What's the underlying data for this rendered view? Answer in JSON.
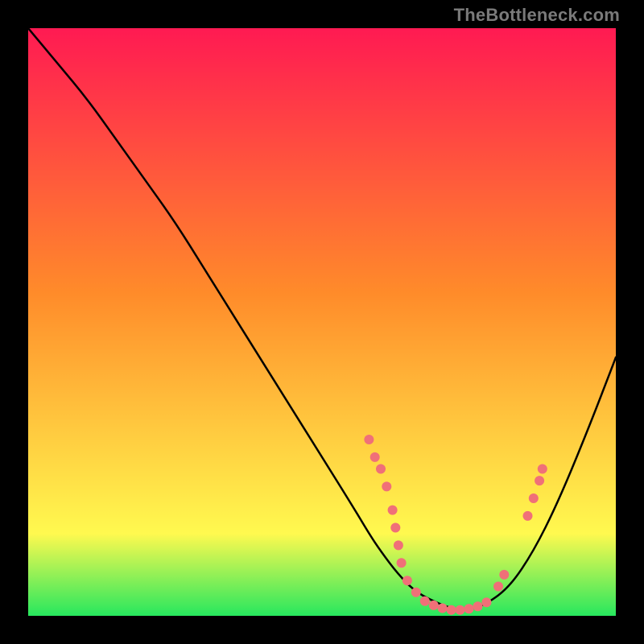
{
  "watermark": "TheBottleneck.com",
  "gradient": {
    "top": "#ff1a52",
    "mid1": "#ff8b2a",
    "mid2": "#fff94f",
    "bottom": "#27e75e"
  },
  "chart_data": {
    "type": "line",
    "title": "",
    "xlabel": "",
    "ylabel": "",
    "xlim": [
      0,
      100
    ],
    "ylim": [
      0,
      100
    ],
    "grid": false,
    "legend": false,
    "annotations": [],
    "series": [
      {
        "name": "bottleneck-curve",
        "x": [
          0,
          5,
          10,
          15,
          20,
          25,
          30,
          35,
          40,
          45,
          50,
          55,
          58,
          60,
          63,
          66,
          70,
          73,
          75,
          78,
          82,
          86,
          90,
          95,
          100
        ],
        "y": [
          100,
          94,
          88,
          81,
          74,
          67,
          59,
          51,
          43,
          35,
          27,
          19,
          14,
          11,
          7,
          4,
          2,
          1,
          1,
          2,
          5,
          11,
          19,
          31,
          44
        ]
      }
    ],
    "scatter_points": {
      "name": "marker-dots",
      "color": "#f07078",
      "points": [
        {
          "x": 58,
          "y": 30
        },
        {
          "x": 59,
          "y": 27
        },
        {
          "x": 60,
          "y": 25
        },
        {
          "x": 61,
          "y": 22
        },
        {
          "x": 62,
          "y": 18
        },
        {
          "x": 62.5,
          "y": 15
        },
        {
          "x": 63,
          "y": 12
        },
        {
          "x": 63.5,
          "y": 9
        },
        {
          "x": 64.5,
          "y": 6
        },
        {
          "x": 66,
          "y": 4
        },
        {
          "x": 67.5,
          "y": 2.5
        },
        {
          "x": 69,
          "y": 1.8
        },
        {
          "x": 70.5,
          "y": 1.3
        },
        {
          "x": 72,
          "y": 1.0
        },
        {
          "x": 73.5,
          "y": 1.0
        },
        {
          "x": 75,
          "y": 1.2
        },
        {
          "x": 76.5,
          "y": 1.6
        },
        {
          "x": 78,
          "y": 2.3
        },
        {
          "x": 80,
          "y": 5
        },
        {
          "x": 81,
          "y": 7
        },
        {
          "x": 85,
          "y": 17
        },
        {
          "x": 86,
          "y": 20
        },
        {
          "x": 87,
          "y": 23
        },
        {
          "x": 87.5,
          "y": 25
        }
      ]
    }
  }
}
